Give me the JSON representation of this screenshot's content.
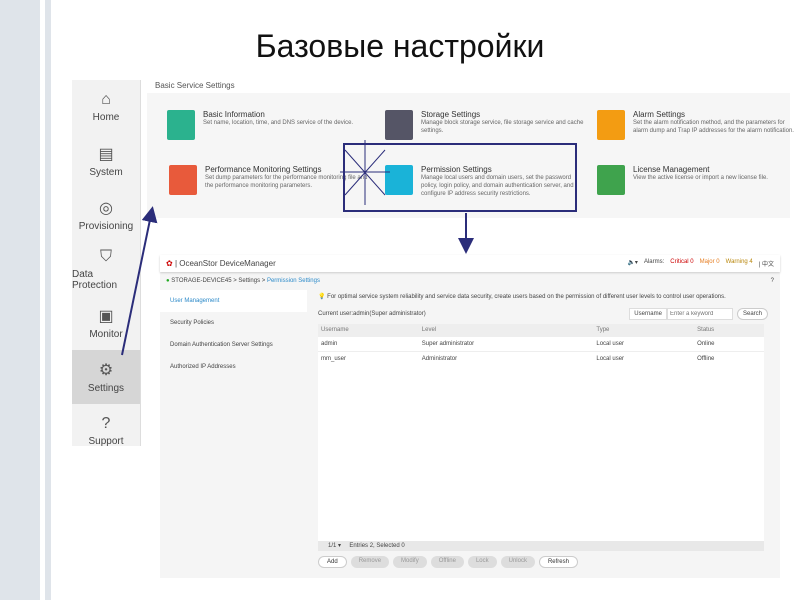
{
  "slide_title": "Базовые настройки",
  "sidebar": [
    {
      "label": "Home",
      "icon": "home-icon"
    },
    {
      "label": "System",
      "icon": "system-icon"
    },
    {
      "label": "Provisioning",
      "icon": "provisioning-icon"
    },
    {
      "label": "Data Protection",
      "icon": "shield-icon"
    },
    {
      "label": "Monitor",
      "icon": "monitor-icon"
    },
    {
      "label": "Settings",
      "icon": "gear-icon"
    },
    {
      "label": "Support",
      "icon": "help-icon"
    }
  ],
  "basic": {
    "header": "Basic Service Settings",
    "cards": [
      {
        "title": "Basic Information",
        "desc": "Set name, location, time, and DNS service of the device."
      },
      {
        "title": "Storage Settings",
        "desc": "Manage block storage service, file storage service and cache settings."
      },
      {
        "title": "Alarm Settings",
        "desc": "Set the alarm notification method, and the parameters for alarm dump and Trap IP addresses for the alarm notification."
      },
      {
        "title": "Performance Monitoring Settings",
        "desc": "Set dump parameters for the performance monitoring file and the performance monitoring parameters."
      },
      {
        "title": "Permission Settings",
        "desc": "Manage local users and domain users, set the password policy, login policy, and domain authentication server, and configure IP address security restrictions."
      },
      {
        "title": "License Management",
        "desc": "View the active license or import a new license file."
      }
    ]
  },
  "dm": {
    "app": "| OceanStor DeviceManager",
    "alarms": "Alarms:",
    "critical": "Critical 0",
    "major": "Major 0",
    "warning": "Warning 4",
    "lang": "| 中文",
    "crumb": [
      "STORAGE-DEVICE45",
      ">",
      "Settings",
      ">",
      "Permission Settings"
    ],
    "help": "?",
    "nav": [
      "User Management",
      "Security Policies",
      "Domain Authentication Server Settings",
      "Authorized IP Addresses"
    ],
    "tip": "For optimal service system reliability and service data security, create users based on the permission of different user levels to control user operations.",
    "current": "Current user:admin(Super administrator)",
    "filter": "Username",
    "search_ph": "Enter a keyword",
    "search": "Search",
    "columns": [
      "Username",
      "Level",
      "Type",
      "Status"
    ],
    "rows": [
      [
        "admin",
        "Super administrator",
        "Local user",
        "Online"
      ],
      [
        "mm_user",
        "Administrator",
        "Local user",
        "Offline"
      ]
    ],
    "page": "1/1",
    "entries": "Entries 2, Selected 0",
    "buttons": [
      "Add",
      "Remove",
      "Modify",
      "Offline",
      "Lock",
      "Unlock",
      "Refresh"
    ]
  }
}
